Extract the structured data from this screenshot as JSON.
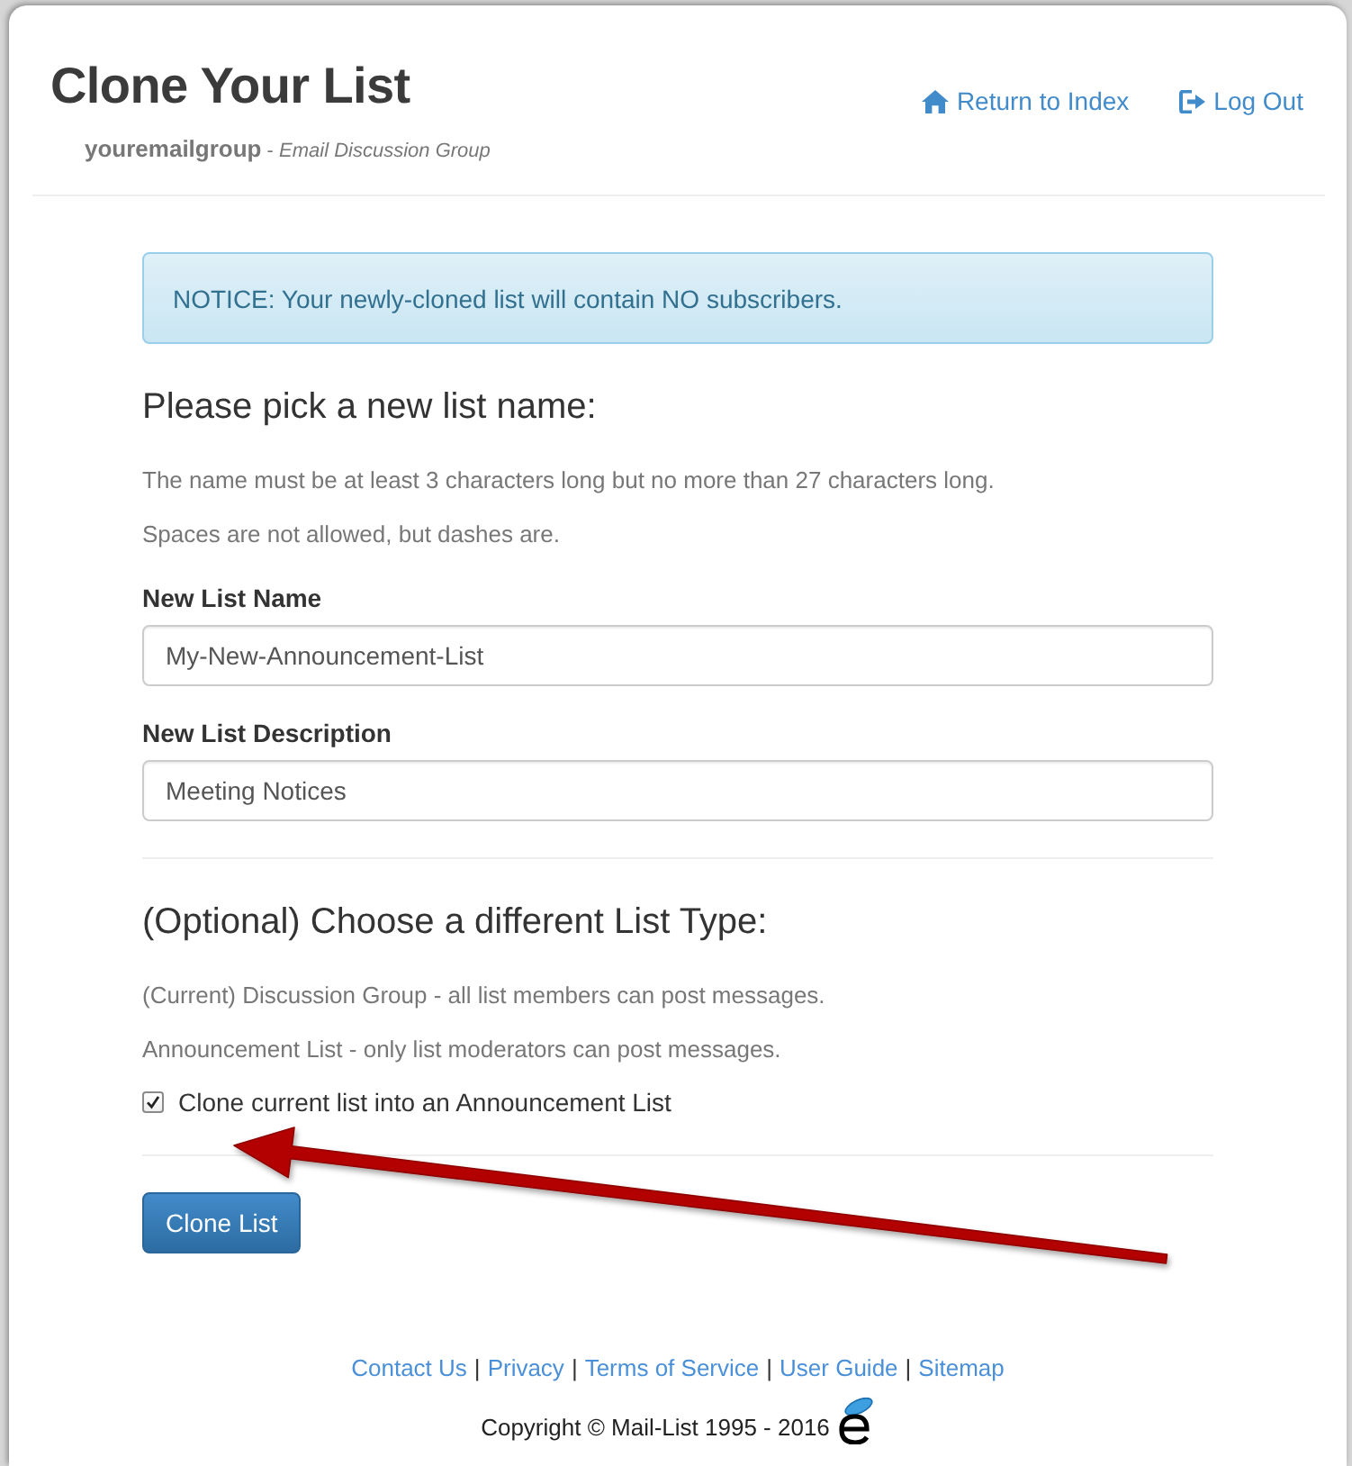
{
  "header": {
    "title": "Clone Your List",
    "subtitle": "**youremailgroup** - *Email Discussion Group*",
    "nav": {
      "return_to_index": "Return to Index",
      "log_out": "Log Out"
    }
  },
  "notice": "NOTICE: Your newly-cloned list will contain NO subscribers.",
  "sections": [
    {
      "heading": "Please pick a new list name:",
      "notes": [
        "The name must be at least 3 characters long but no more than 27 characters long.",
        "Spaces are not allowed, but dashes are."
      ],
      "fields": [
        {
          "label": "New List Name",
          "value": "My-New-Announcement-List"
        },
        {
          "label": "New List Description",
          "value": "Meeting Notices"
        }
      ]
    },
    {
      "heading": "(Optional) Choose a different List Type:",
      "notes": [
        "(Current) Discussion Group - all list members can post messages.",
        "Announcement List - only list moderators can post messages."
      ],
      "checkbox": {
        "label": "Clone current list into an Announcement List",
        "checked": true
      }
    }
  ],
  "submit": "Clone List",
  "footer": {
    "items": [
      {
        "kind": "link",
        "text": "Contact Us"
      },
      {
        "kind": "separator",
        "text": "|"
      },
      {
        "kind": "link",
        "text": "Privacy"
      },
      {
        "kind": "separator",
        "text": "|"
      },
      {
        "kind": "link",
        "text": "Terms of Service"
      },
      {
        "kind": "separator",
        "text": "|"
      },
      {
        "kind": "link",
        "text": "User Guide"
      },
      {
        "kind": "separator",
        "text": "|"
      },
      {
        "kind": "link",
        "text": "Sitemap"
      }
    ],
    "copyright": "Copyright © Mail-List 1995 - 2016"
  }
}
